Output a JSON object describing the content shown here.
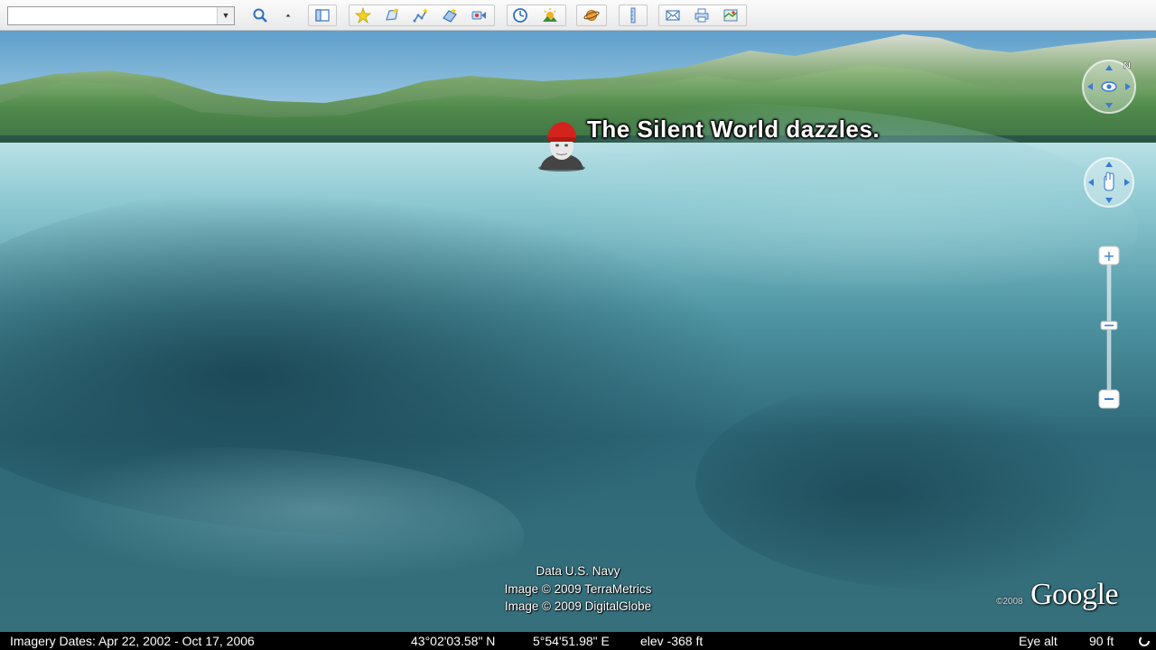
{
  "toolbar": {
    "search": {
      "value": "",
      "placeholder": ""
    },
    "icons": [
      "search-icon",
      "collapse-arrow-icon",
      "sidebar-toggle-icon",
      "add-placemark-icon",
      "add-polygon-icon",
      "add-path-icon",
      "add-image-overlay-icon",
      "record-tour-icon",
      "historical-imagery-icon",
      "sunlight-icon",
      "switch-planet-icon",
      "ruler-icon",
      "email-icon",
      "print-icon",
      "view-in-maps-icon"
    ]
  },
  "scene": {
    "caption": "The Silent World dazzles.",
    "attribution": [
      "Data U.S. Navy",
      "Image © 2009 TerraMetrics",
      "Image © 2009 DigitalGlobe"
    ],
    "logo": "Google",
    "logo_year": "©2008",
    "compass_label": "N"
  },
  "status": {
    "imagery_dates": "Imagery Dates: Apr 22, 2002 - Oct 17, 2006",
    "latitude": "43°02'03.58\" N",
    "longitude": "5°54'51.98\" E",
    "elevation": "elev  -368 ft",
    "eye_alt_label": "Eye alt",
    "eye_alt_value": "90 ft"
  },
  "colors": {
    "water_light": "#8ec9d2",
    "water_deep": "#1f5666",
    "accent_blue": "#2d6fc0"
  }
}
